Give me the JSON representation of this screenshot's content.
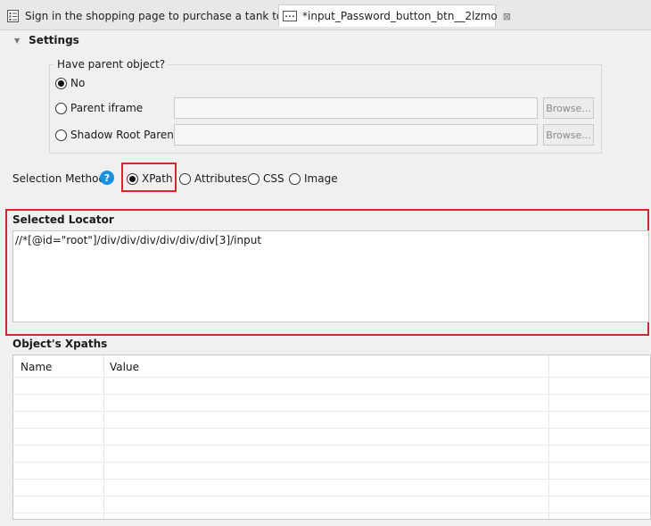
{
  "tabs": [
    {
      "label": "Sign in the shopping page to purchase a tank top",
      "icon": "test-case-icon",
      "active": false
    },
    {
      "label": "*input_Password_button_btn__2lzmo",
      "icon": "test-object-icon",
      "active": true,
      "close": "⊠"
    }
  ],
  "settings": {
    "title": "Settings",
    "parent_group": {
      "legend": "Have parent object?",
      "options": [
        {
          "label": "No",
          "checked": true
        },
        {
          "label": "Parent iframe",
          "checked": false,
          "browse_label": "Browse..."
        },
        {
          "label": "Shadow Root Parent",
          "checked": false,
          "browse_label": "Browse..."
        }
      ]
    }
  },
  "selection_method": {
    "label": "Selection Method",
    "help_glyph": "?",
    "options": [
      {
        "label": "XPath",
        "checked": true
      },
      {
        "label": "Attributes",
        "checked": false
      },
      {
        "label": "CSS",
        "checked": false
      },
      {
        "label": "Image",
        "checked": false
      }
    ]
  },
  "selected_locator": {
    "title": "Selected Locator",
    "value": "//*[@id=\"root\"]/div/div/div/div/div/div[3]/input"
  },
  "object_xpaths": {
    "title": "Object's Xpaths",
    "columns": [
      "Name",
      "Value"
    ]
  },
  "colors": {
    "highlight": "#d6262f",
    "help_icon": "#1a8fe0"
  }
}
